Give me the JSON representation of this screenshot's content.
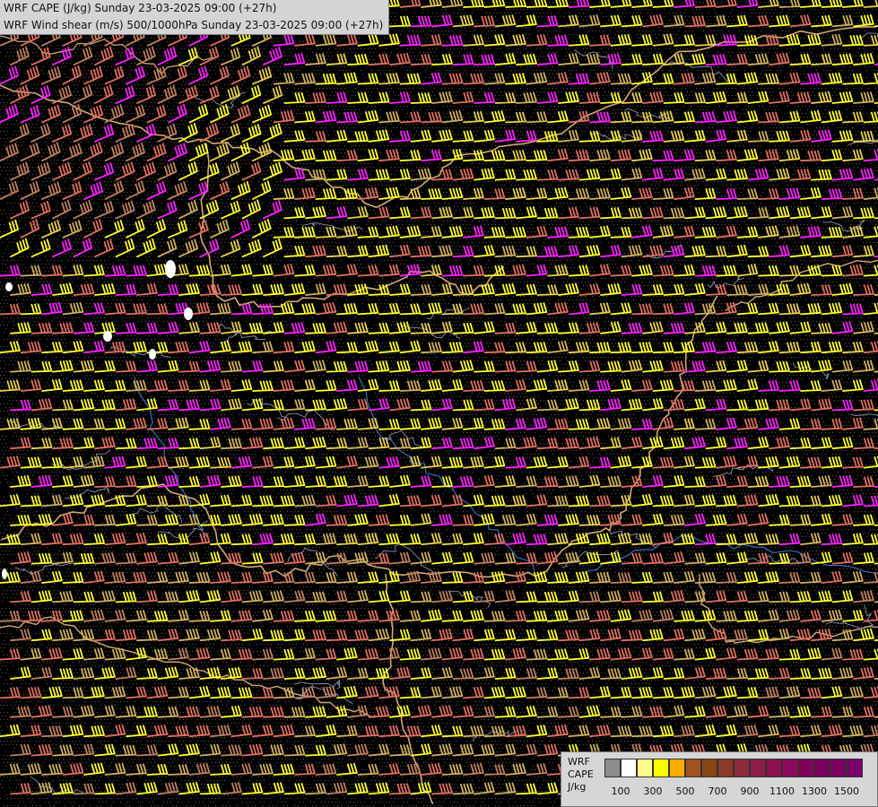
{
  "title": {
    "line1": "WRF CAPE (J/kg) Sunday 23-03-2025 09:00 (+27h)",
    "line2": "WRF Wind shear (m/s) 500/1000hPa Sunday 23-03-2025 09:00 (+27h)"
  },
  "legend": {
    "label_wrf": "WRF",
    "label_cape": "CAPE",
    "label_unit": "J/kg",
    "ticks": [
      "100",
      "300",
      "500",
      "700",
      "900",
      "1100",
      "1300",
      "1500"
    ],
    "colors": [
      "#8c8c8c",
      "#ffffff",
      "#fffa8c",
      "#ffff00",
      "#ffae00",
      "#a0521e",
      "#8b4513",
      "#8b3a2a",
      "#8b2c3b",
      "#8b1e4a",
      "#8b1050",
      "#8b0a5a",
      "#80005a",
      "#7a0060",
      "#780065",
      "#7a006a"
    ]
  },
  "map_colors": {
    "background": "#000000",
    "barb_colors": [
      "#ffff30",
      "#e8d050",
      "#e07060",
      "#ff20ff",
      "#c08060",
      "#d0b060"
    ],
    "border": "#d2aa78",
    "river": "#3a78c8",
    "contour": "#9aa4c0"
  }
}
